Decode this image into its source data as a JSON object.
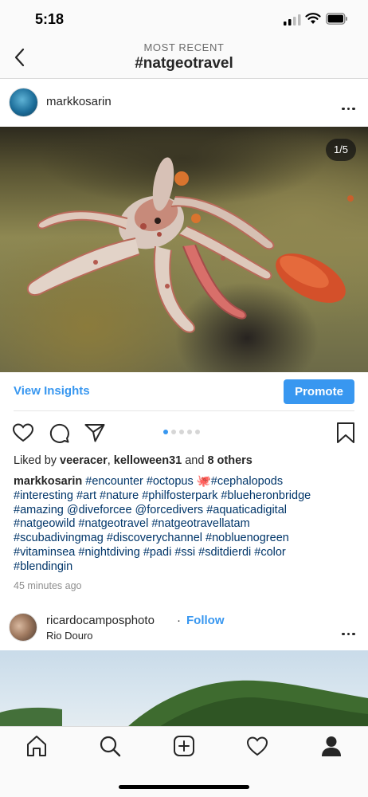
{
  "status_bar": {
    "time": "5:18",
    "icons": [
      "cellular-signal-icon",
      "wifi-icon",
      "battery-icon"
    ]
  },
  "header": {
    "subtitle": "MOST RECENT",
    "title": "#natgeotravel",
    "back_icon": "chevron-left-icon"
  },
  "post": {
    "username": "markkosarin",
    "media_counter": "1/5",
    "insights_label": "View Insights",
    "promote_label": "Promote",
    "carousel": {
      "current": 1,
      "total": 5
    },
    "likes": {
      "prefix": "Liked by ",
      "user1": "veeracer",
      "comma": ", ",
      "user2": "kelloween31",
      "and": " and ",
      "others": "8 others"
    },
    "caption": {
      "username": "markkosarin",
      "tags_line1": "#encounter #octopus 🐙#cephalopods",
      "lines": [
        "#interesting #art #nature #philfosterpark #blueheronbridge",
        "#amazing @diveforcee @forcedivers #aquaticadigital",
        "#natgeowild #natgeotravel #natgeotravellatam",
        "#scubadivingmag #discoverychannel #nobluenogreen",
        "#vitaminsea #nightdiving #padi #ssi #sditdierdi #color",
        "#blendingin"
      ]
    },
    "time_ago": "45 minutes ago"
  },
  "post2": {
    "username": "ricardocamposphoto",
    "separator": "·",
    "follow_label": "Follow",
    "location": "Rio Douro"
  },
  "tab_bar": {
    "items": [
      "home-icon",
      "search-icon",
      "new-post-icon",
      "activity-heart-icon",
      "profile-icon"
    ]
  },
  "colors": {
    "accent": "#3897f0",
    "hashtag": "#003569",
    "text": "#262626",
    "muted": "#8e8e8e"
  }
}
